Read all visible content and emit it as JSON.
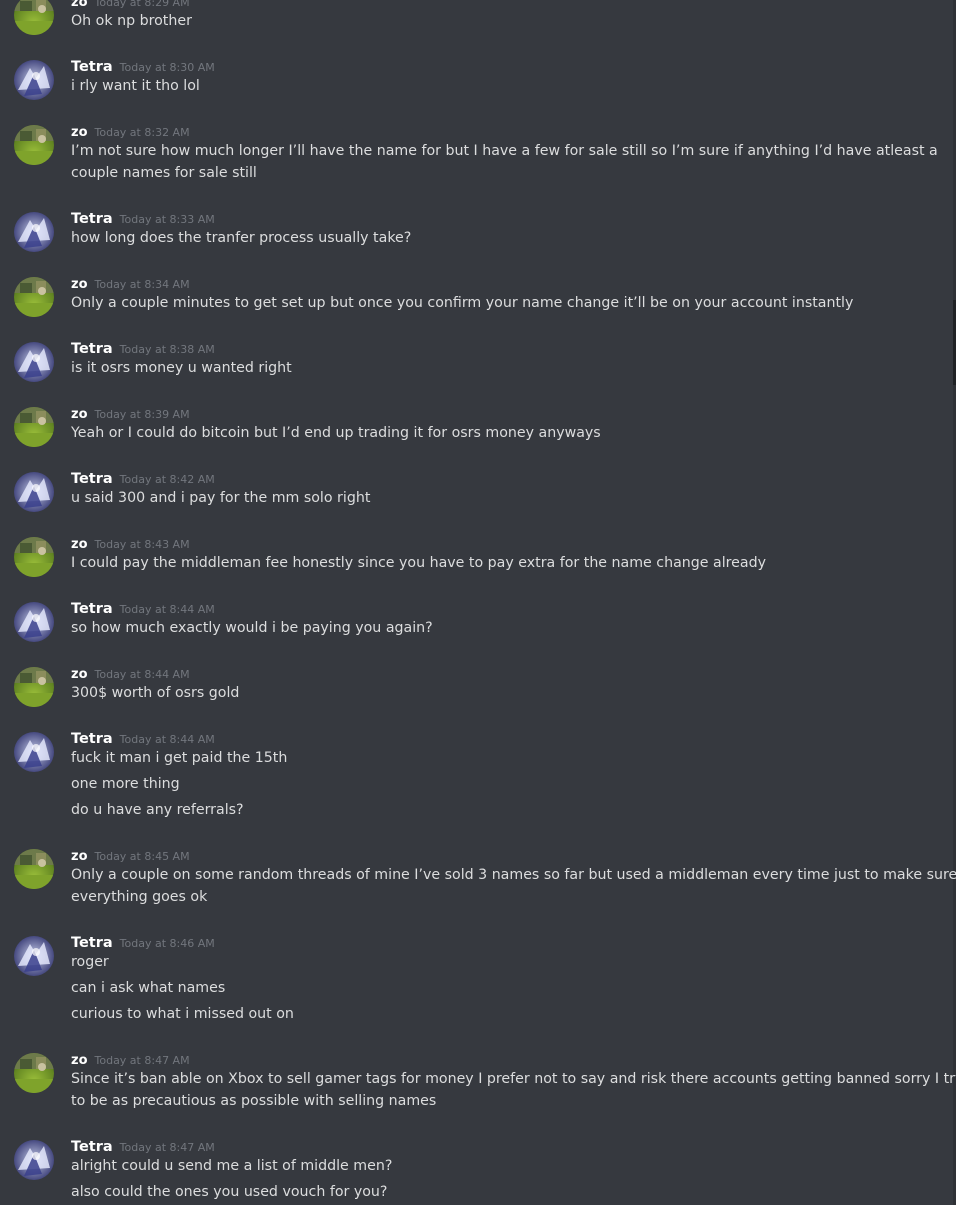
{
  "users": {
    "zo": {
      "name": "zo"
    },
    "tetra": {
      "name": "Tetra"
    }
  },
  "messages": [
    {
      "user": "zo",
      "time": "Today at 8:29 AM",
      "lines": [
        "Oh ok np brother"
      ]
    },
    {
      "user": "Tetra",
      "time": "Today at 8:30 AM",
      "lines": [
        "i rly want it tho lol"
      ]
    },
    {
      "user": "zo",
      "time": "Today at 8:32 AM",
      "lines": [
        "I’m not sure how much longer I’ll have the name for but I have a few for sale still so I’m sure if anything I’d have atleast a",
        "couple names for sale still"
      ]
    },
    {
      "user": "Tetra",
      "time": "Today at 8:33 AM",
      "lines": [
        "how long does the tranfer process usually take?"
      ]
    },
    {
      "user": "zo",
      "time": "Today at 8:34 AM",
      "lines": [
        "Only a couple minutes to get set up but once you confirm your name change it’ll be on your account instantly"
      ]
    },
    {
      "user": "Tetra",
      "time": "Today at 8:38 AM",
      "lines": [
        "is it osrs money u wanted right"
      ]
    },
    {
      "user": "zo",
      "time": "Today at 8:39 AM",
      "lines": [
        "Yeah or I could do bitcoin but I’d end up trading it for osrs money anyways"
      ]
    },
    {
      "user": "Tetra",
      "time": "Today at 8:42 AM",
      "lines": [
        "u said 300 and i pay for the mm solo right"
      ]
    },
    {
      "user": "zo",
      "time": "Today at 8:43 AM",
      "lines": [
        "I could pay the middleman fee honestly since you have to pay extra for the name change already"
      ]
    },
    {
      "user": "Tetra",
      "time": "Today at 8:44 AM",
      "lines": [
        "so how much exactly would i be paying you again?"
      ]
    },
    {
      "user": "zo",
      "time": "Today at 8:44 AM",
      "lines": [
        "300$ worth of osrs gold"
      ]
    },
    {
      "user": "Tetra",
      "time": "Today at 8:44 AM",
      "lines": [
        "fuck it man i get paid the 15th",
        "one more thing",
        "do u have any referrals?"
      ]
    },
    {
      "user": "zo",
      "time": "Today at 8:45 AM",
      "lines": [
        "Only a couple on some random threads of mine I’ve sold 3 names so far but used a middleman every time just to make sure",
        "everything goes ok"
      ]
    },
    {
      "user": "Tetra",
      "time": "Today at 8:46 AM",
      "lines": [
        "roger",
        "can i ask what names",
        "curious to what i missed out on"
      ]
    },
    {
      "user": "zo",
      "time": "Today at 8:47 AM",
      "lines": [
        "Since it’s ban able on Xbox to sell gamer tags for money I prefer not to say and risk there accounts getting banned sorry I try",
        "to be as precautious as possible with selling names"
      ]
    },
    {
      "user": "Tetra",
      "time": "Today at 8:47 AM",
      "lines": [
        "alright could u send me a list of middle men?",
        "also could the ones you used vouch for you?"
      ]
    }
  ]
}
